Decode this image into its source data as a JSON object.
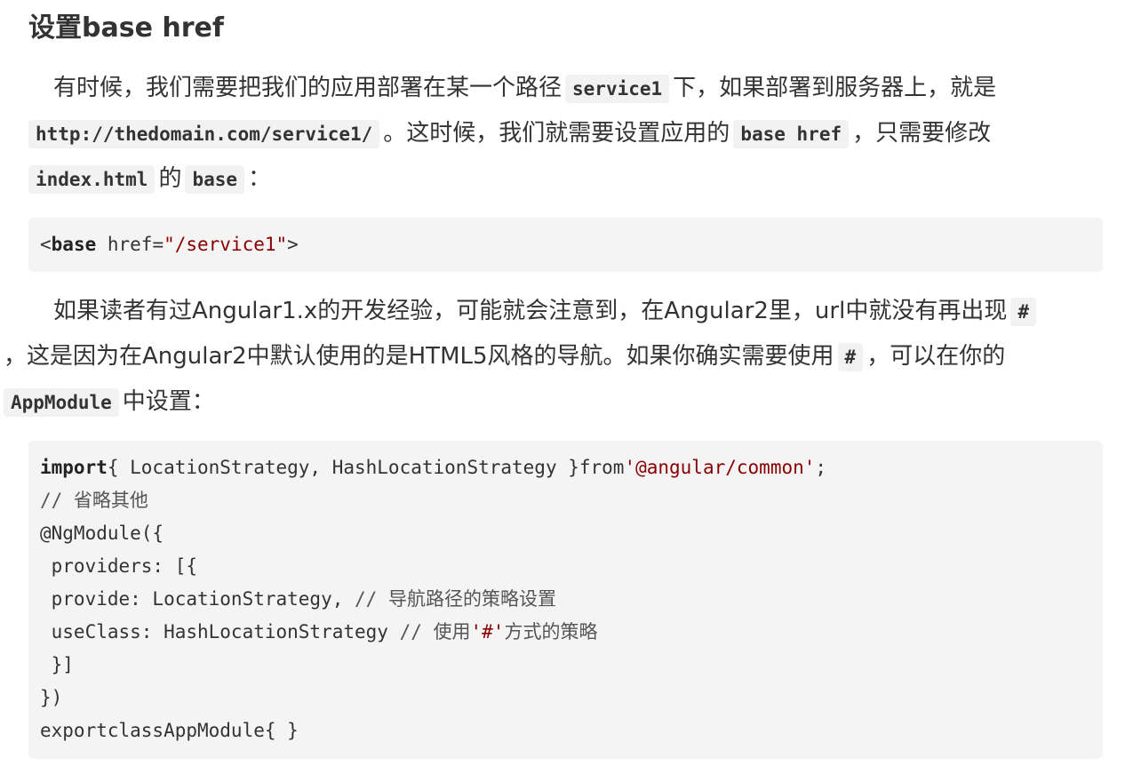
{
  "heading": "设置base href",
  "paragraph1": {
    "t1": "有时候，我们需要把我们的应用部署在某一个路径",
    "c1": "service1",
    "t2": "下，如果部署到服务器上，就是",
    "c2": "http://thedomain.com/service1/",
    "t3": "。这时候，我们就需要设置应用的",
    "c3": "base href",
    "t4": "，只需要修改",
    "c4": "index.html",
    "t5": "的",
    "c5": "base",
    "t6": "："
  },
  "code1": {
    "lt": "<",
    "tag": "base",
    "attr": " href=",
    "value": "\"/service1\"",
    "gt": ">"
  },
  "paragraph2": {
    "t1": "如果读者有过Angular1.x的开发经验，可能就会注意到，在Angular2里，url中就没有再出现",
    "c1": "#",
    "t2": "，这是因为在Angular2中默认使用的是HTML5风格的导航。如果你确实需要使用",
    "c2": "#",
    "t3": "，可以在你的",
    "c3": "AppModule",
    "t4": "中设置："
  },
  "code2": {
    "l1_kw": "import",
    "l1_mid": "{ LocationStrategy, HashLocationStrategy }from",
    "l1_str": "'@angular/common'",
    "l1_end": ";",
    "l2": "// 省略其他",
    "l3": "@NgModule({",
    "l4": " providers: [{",
    "l5_code": " provide: LocationStrategy, ",
    "l5_cm": "// 导航路径的策略设置",
    "l6_code": " useClass: HashLocationStrategy ",
    "l6_cm": "// 使用",
    "l6_str": "'#'",
    "l6_cm2": "方式的策略",
    "l7": " }]",
    "l8": "})",
    "l9": "exportclassAppModule{ }"
  }
}
